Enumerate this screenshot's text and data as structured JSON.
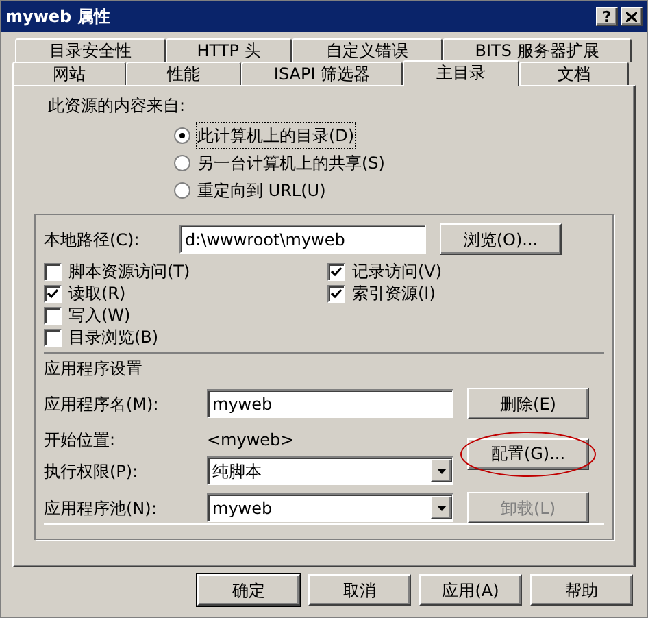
{
  "window": {
    "title": "myweb 属性",
    "help_button": "?"
  },
  "tabs": [
    [
      {
        "label": "目录安全性",
        "selected": false
      },
      {
        "label": "HTTP 头",
        "selected": false
      },
      {
        "label": "自定义错误",
        "selected": false
      },
      {
        "label": "BITS 服务器扩展",
        "selected": false
      }
    ],
    [
      {
        "label": "网站",
        "selected": false
      },
      {
        "label": "性能",
        "selected": false
      },
      {
        "label": "ISAPI 筛选器",
        "selected": false
      },
      {
        "label": "主目录",
        "selected": true
      },
      {
        "label": "文档",
        "selected": false
      }
    ]
  ],
  "source": {
    "label": "此资源的内容来自:",
    "options": [
      {
        "label": "此计算机上的目录(D)",
        "selected": true
      },
      {
        "label": "另一台计算机上的共享(S)",
        "selected": false
      },
      {
        "label": "重定向到 URL(U)",
        "selected": false
      }
    ]
  },
  "local_path": {
    "label": "本地路径(C):",
    "value": "d:\\wwwroot\\myweb",
    "browse_button": "浏览(O)..."
  },
  "permissions_left": [
    {
      "label": "脚本资源访问(T)",
      "checked": false
    },
    {
      "label": "读取(R)",
      "checked": true
    },
    {
      "label": "写入(W)",
      "checked": false
    },
    {
      "label": "目录浏览(B)",
      "checked": false
    }
  ],
  "permissions_right": [
    {
      "label": "记录访问(V)",
      "checked": true
    },
    {
      "label": "索引资源(I)",
      "checked": true
    }
  ],
  "app_settings": {
    "title": "应用程序设置",
    "name_label": "应用程序名(M):",
    "name_value": "myweb",
    "remove_button": {
      "label": "删除(E)",
      "disabled": false
    },
    "start_label": "开始位置:",
    "start_value": "<myweb>",
    "configure_button": {
      "label": "配置(G)...",
      "disabled": false,
      "circled": true
    },
    "exec_label": "执行权限(P):",
    "exec_value": "纯脚本",
    "unload_button": {
      "label": "卸载(L)",
      "disabled": true
    },
    "pool_label": "应用程序池(N):",
    "pool_value": "myweb"
  },
  "buttons": [
    {
      "label": "确定",
      "default": true
    },
    {
      "label": "取消",
      "default": false
    },
    {
      "label": "应用(A)",
      "default": false
    },
    {
      "label": "帮助",
      "default": false
    }
  ]
}
